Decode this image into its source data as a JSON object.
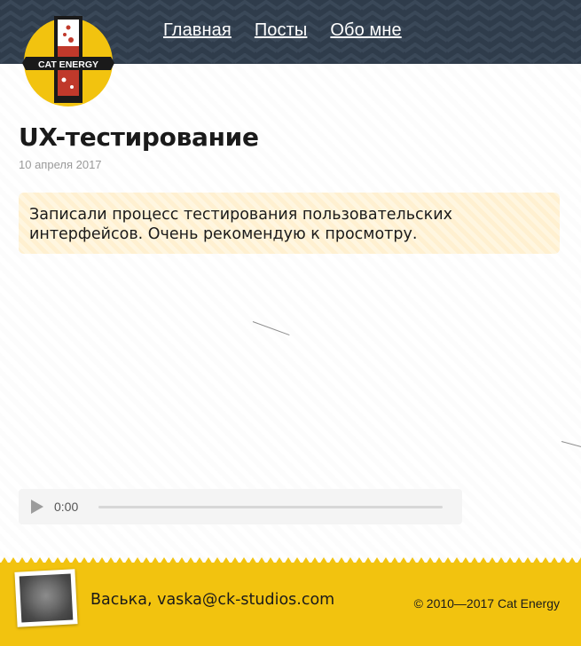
{
  "header": {
    "logo_text": "CAT ENERGY",
    "nav": [
      "Главная",
      "Посты",
      "Обо мне"
    ]
  },
  "article": {
    "title": "UX-тестирование",
    "date": "10 апреля 2017",
    "body": "Записали процесс тестирования пользовательских интерфейсов. Очень рекомендую к просмотру."
  },
  "audio": {
    "time": "0:00"
  },
  "footer": {
    "author": "Васька, vaska@ck-studios.com",
    "copyright": "© 2010—2017 Cat Energy"
  },
  "colors": {
    "header_bg": "#2f3c4b",
    "footer_bg": "#f2c30f",
    "note_bg": "#fff6e0",
    "logo_bg": "#f2c30f",
    "logo_accent": "#c0392b"
  }
}
